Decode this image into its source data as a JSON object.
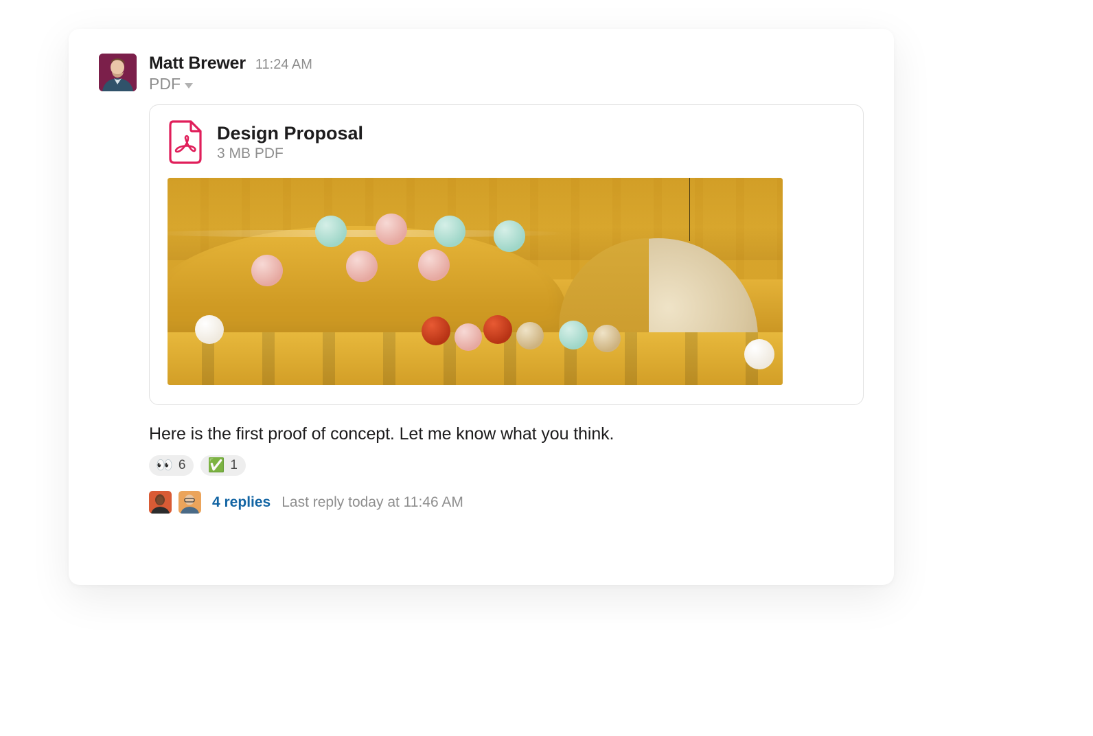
{
  "message": {
    "author_name": "Matt Brewer",
    "timestamp": "11:24 AM",
    "attachment_type_label": "PDF",
    "attachment": {
      "title": "Design Proposal",
      "subtitle": "3 MB PDF"
    },
    "text": "Here is the first proof of concept. Let me know what you think."
  },
  "reactions": [
    {
      "emoji": "👀",
      "count": "6"
    },
    {
      "emoji": "✅",
      "count": "1"
    }
  ],
  "thread": {
    "replies_label": "4 replies",
    "last_reply_label": "Last reply today at 11:46 AM"
  },
  "colors": {
    "author_avatar_bg": "#7b1f4a",
    "link": "#1264a3"
  }
}
